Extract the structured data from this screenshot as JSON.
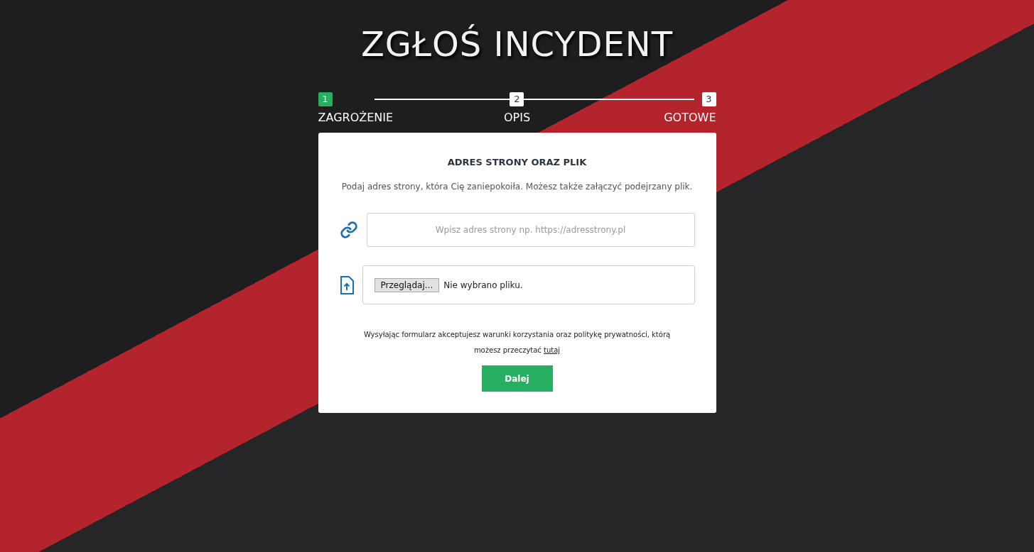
{
  "title": "ZGŁOŚ INCYDENT",
  "steps": [
    {
      "number": "1",
      "label": "ZAGROŻENIE",
      "selected": true
    },
    {
      "number": "2",
      "label": "OPIS",
      "selected": false
    },
    {
      "number": "3",
      "label": "GOTOWE",
      "selected": false
    }
  ],
  "card": {
    "heading": "ADRES STRONY ORAZ PLIK",
    "description": "Podaj adres strony, która Cię zaniepokoiła. Możesz także załączyć podejrzany plik.",
    "url_field": {
      "placeholder": "Wpisz adres strony np. https://adresstrony.pl"
    },
    "file_field": {
      "button": "Przeglądaj...",
      "status": "Nie wybrano pliku."
    },
    "consent": {
      "text": "Wysyłając formularz akceptujesz warunki korzystania oraz politykę prywatności, którą możesz przeczytać ",
      "link": "tutaj"
    },
    "submit": "Dalej"
  }
}
